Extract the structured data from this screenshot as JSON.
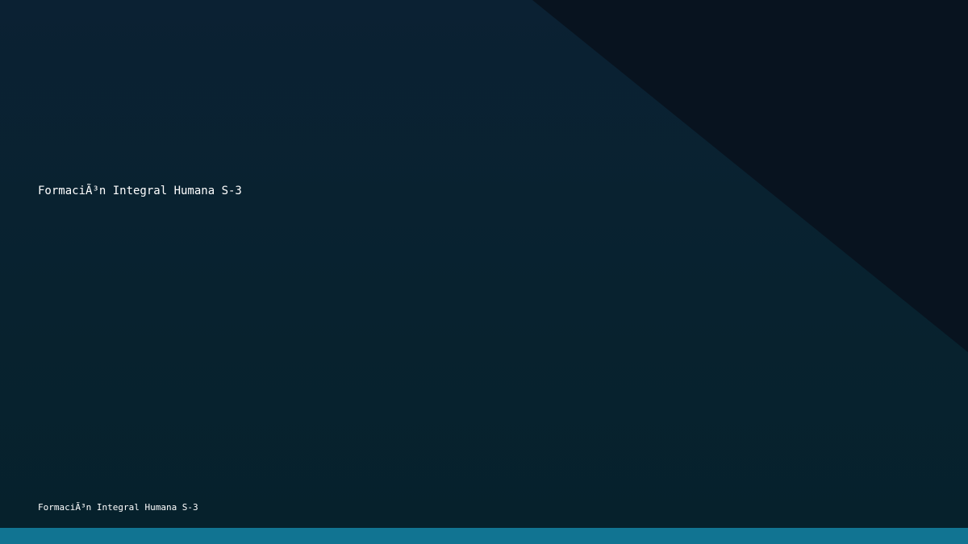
{
  "slide": {
    "title": "FormaciÃ³n Integral Humana S-3",
    "footer": "FormaciÃ³n Integral Humana S-3"
  },
  "colors": {
    "background": "#0a2232",
    "corner_shape": "#08131f",
    "bottom_bar": "#117492",
    "text": "#ffffff"
  }
}
